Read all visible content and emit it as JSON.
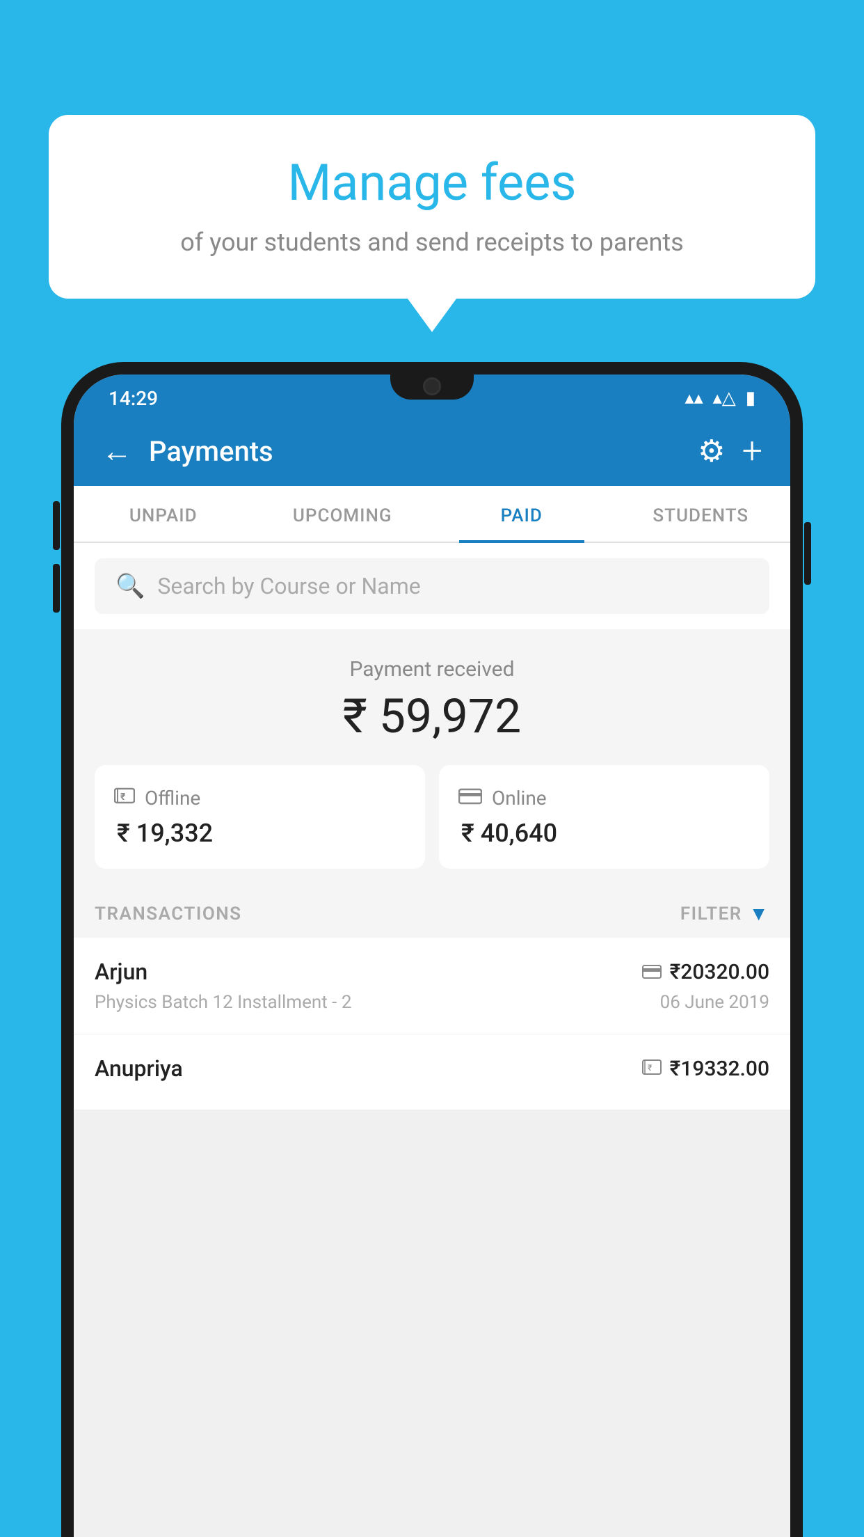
{
  "background": {
    "color": "#29B6E8"
  },
  "speech_bubble": {
    "title": "Manage fees",
    "subtitle": "of your students and send receipts to parents"
  },
  "status_bar": {
    "time": "14:29",
    "wifi_icon": "▾",
    "signal_icon": "▲",
    "battery_icon": "▮"
  },
  "header": {
    "title": "Payments",
    "back_label": "←",
    "gear_label": "⚙",
    "plus_label": "+"
  },
  "tabs": [
    {
      "id": "unpaid",
      "label": "UNPAID",
      "active": false
    },
    {
      "id": "upcoming",
      "label": "UPCOMING",
      "active": false
    },
    {
      "id": "paid",
      "label": "PAID",
      "active": true
    },
    {
      "id": "students",
      "label": "STUDENTS",
      "active": false
    }
  ],
  "search": {
    "placeholder": "Search by Course or Name"
  },
  "payment_section": {
    "label": "Payment received",
    "amount": "₹ 59,972"
  },
  "payment_cards": [
    {
      "id": "offline",
      "icon": "₹",
      "label": "Offline",
      "amount": "₹ 19,332"
    },
    {
      "id": "online",
      "icon": "▭",
      "label": "Online",
      "amount": "₹ 40,640"
    }
  ],
  "transactions_section": {
    "label": "TRANSACTIONS",
    "filter_label": "FILTER"
  },
  "transactions": [
    {
      "name": "Arjun",
      "payment_icon": "▭",
      "amount": "₹20320.00",
      "detail": "Physics Batch 12 Installment - 2",
      "date": "06 June 2019"
    },
    {
      "name": "Anupriya",
      "payment_icon": "₹",
      "amount": "₹19332.00",
      "detail": "",
      "date": ""
    }
  ]
}
